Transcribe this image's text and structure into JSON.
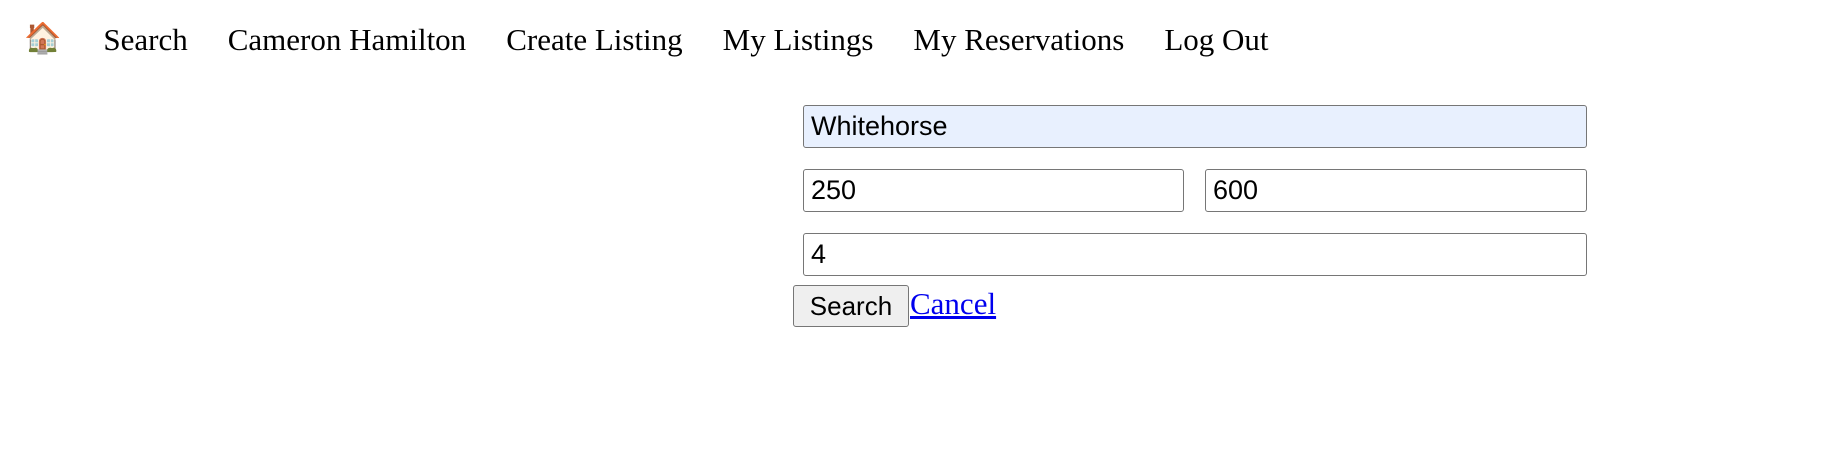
{
  "nav": {
    "home_icon": "🏠",
    "items": [
      {
        "label": "Search"
      },
      {
        "label": "Cameron Hamilton"
      },
      {
        "label": "Create Listing"
      },
      {
        "label": "My Listings"
      },
      {
        "label": "My Reservations"
      },
      {
        "label": "Log Out"
      }
    ]
  },
  "search_form": {
    "location": "Whitehorse",
    "min_price": "250",
    "max_price": "600",
    "guests": "4",
    "search_label": "Search",
    "cancel_label": "Cancel"
  },
  "colors": {
    "autofill_bg": "#e8f0fe",
    "link": "#0000ee",
    "button_bg": "#efefef"
  }
}
